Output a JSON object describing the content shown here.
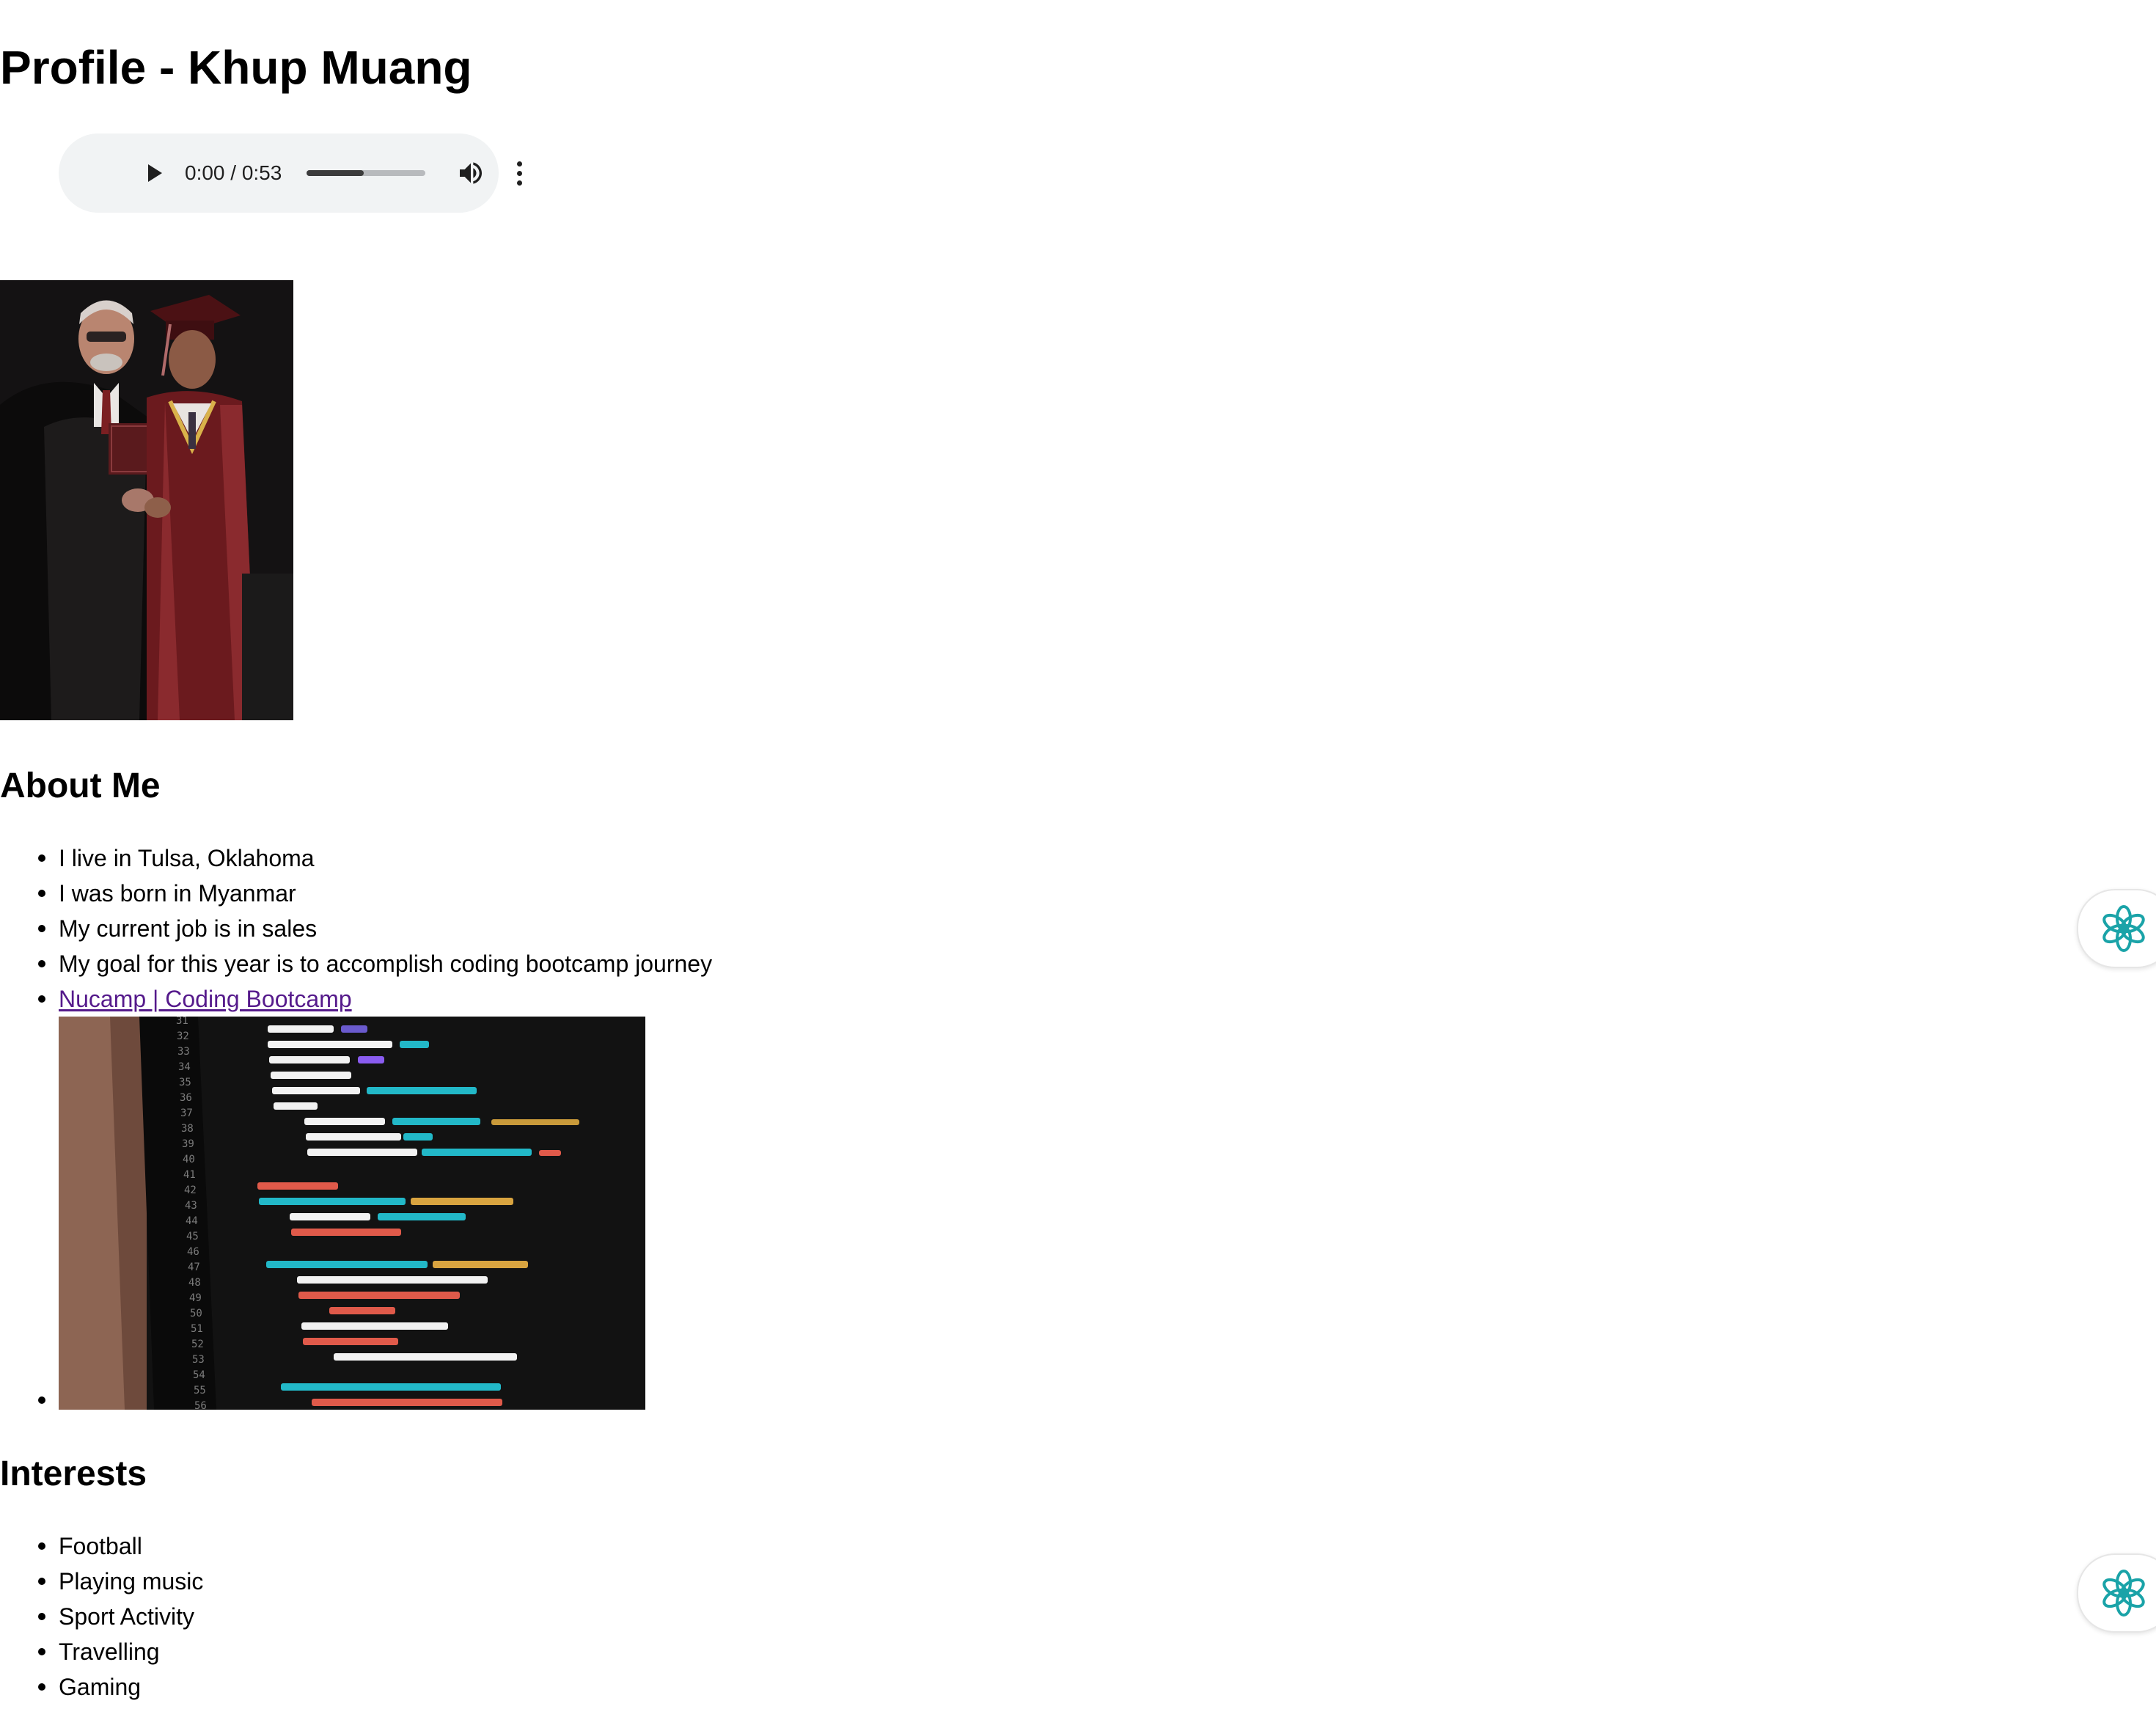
{
  "page": {
    "title": "Profile - Khup Muang"
  },
  "audio": {
    "time_readout": "0:00 / 0:53",
    "buffered_fraction": 0.48,
    "icons": {
      "play": "play-icon",
      "volume": "volume-icon",
      "menu": "more-vert-icon"
    }
  },
  "photos": {
    "graduation": "graduation-photo",
    "code": "code-screen-photo"
  },
  "about": {
    "heading": "About Me",
    "items": [
      "I live in Tulsa, Oklahoma",
      "I was born in Myanmar",
      "My current job is in sales",
      "My goal for this year is to accomplish coding bootcamp journey"
    ],
    "link_label": "Nucamp | Coding Bootcamp"
  },
  "interests": {
    "heading": "Interests",
    "items": [
      "Football",
      "Playing music",
      "Sport Activity",
      "Travelling",
      "Gaming"
    ]
  },
  "colors": {
    "link_visited": "#551a8b",
    "player_bg": "#f1f3f4",
    "assistant_icon": "#1aa3a8"
  },
  "widgets": {
    "assistant_icon": "assistant-flower-icon"
  }
}
